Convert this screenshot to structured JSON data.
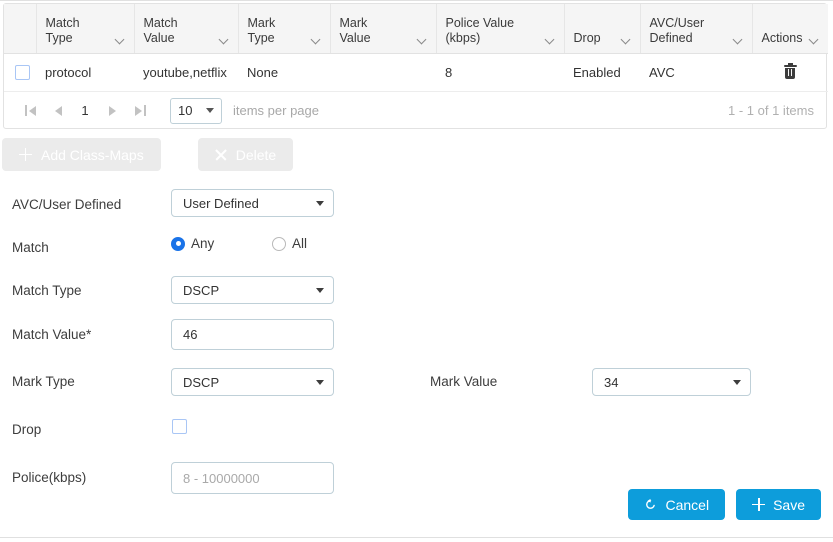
{
  "table": {
    "columns": [
      {
        "key": "select",
        "label": ""
      },
      {
        "key": "match_type",
        "label": "Match Type"
      },
      {
        "key": "match_value",
        "label": "Match Value"
      },
      {
        "key": "mark_type",
        "label": "Mark Type"
      },
      {
        "key": "mark_value",
        "label": "Mark Value"
      },
      {
        "key": "police_value",
        "label": "Police Value (kbps)"
      },
      {
        "key": "drop",
        "label": "Drop"
      },
      {
        "key": "avc_user",
        "label": "AVC/User Defined"
      },
      {
        "key": "actions",
        "label": "Actions"
      }
    ],
    "headers": {
      "match_type_l1": "Match",
      "match_type_l2": "Type",
      "match_value_l1": "Match",
      "match_value_l2": "Value",
      "mark_type_l1": "Mark",
      "mark_type_l2": "Type",
      "mark_value_l1": "Mark",
      "mark_value_l2": "Value",
      "police_l1": "Police Value",
      "police_l2": "(kbps)",
      "drop": "Drop",
      "avc_l1": "AVC/User",
      "avc_l2": "Defined",
      "actions": "Actions"
    },
    "rows": [
      {
        "selected": false,
        "match_type": "protocol",
        "match_value": "youtube,netflix",
        "mark_type": "None",
        "mark_value": "",
        "police_value": "8",
        "drop": "Enabled",
        "avc_user": "AVC",
        "action_icon": "trash-icon"
      }
    ]
  },
  "pagination": {
    "first_icon": "first-page-icon",
    "prev_icon": "previous-page-icon",
    "current_page": "1",
    "next_icon": "next-page-icon",
    "last_icon": "last-page-icon",
    "items_per_page_value": "10",
    "items_per_page_label": "items per page",
    "range_text": "1 - 1 of 1 items"
  },
  "toolbar": {
    "add_label": "Add Class-Maps",
    "add_icon": "plus-icon",
    "add_disabled": true,
    "delete_label": "Delete",
    "delete_icon": "close-icon",
    "delete_disabled": true
  },
  "form": {
    "avc_user_defined": {
      "label": "AVC/User Defined",
      "value": "User Defined"
    },
    "match": {
      "label": "Match",
      "options": [
        {
          "label": "Any",
          "selected": true
        },
        {
          "label": "All",
          "selected": false
        }
      ]
    },
    "match_type": {
      "label": "Match Type",
      "value": "DSCP"
    },
    "match_value": {
      "label": "Match Value*",
      "value": "46"
    },
    "mark_type": {
      "label": "Mark Type",
      "value": "DSCP"
    },
    "mark_value": {
      "label": "Mark Value",
      "value": "34"
    },
    "drop": {
      "label": "Drop",
      "checked": false
    },
    "police": {
      "label": "Police(kbps)",
      "value": "",
      "placeholder": "8 - 10000000"
    }
  },
  "footer": {
    "cancel_label": "Cancel",
    "cancel_icon": "undo-icon",
    "save_label": "Save",
    "save_icon": "plus-icon"
  },
  "colors": {
    "primary_blue": "#0d9ddb",
    "radio_blue": "#1a73e8",
    "checkbox_border": "#a9c6f5",
    "input_border": "#bfd0d8",
    "header_bg": "#f5f5f5",
    "disabled_btn": "#ebebeb"
  }
}
